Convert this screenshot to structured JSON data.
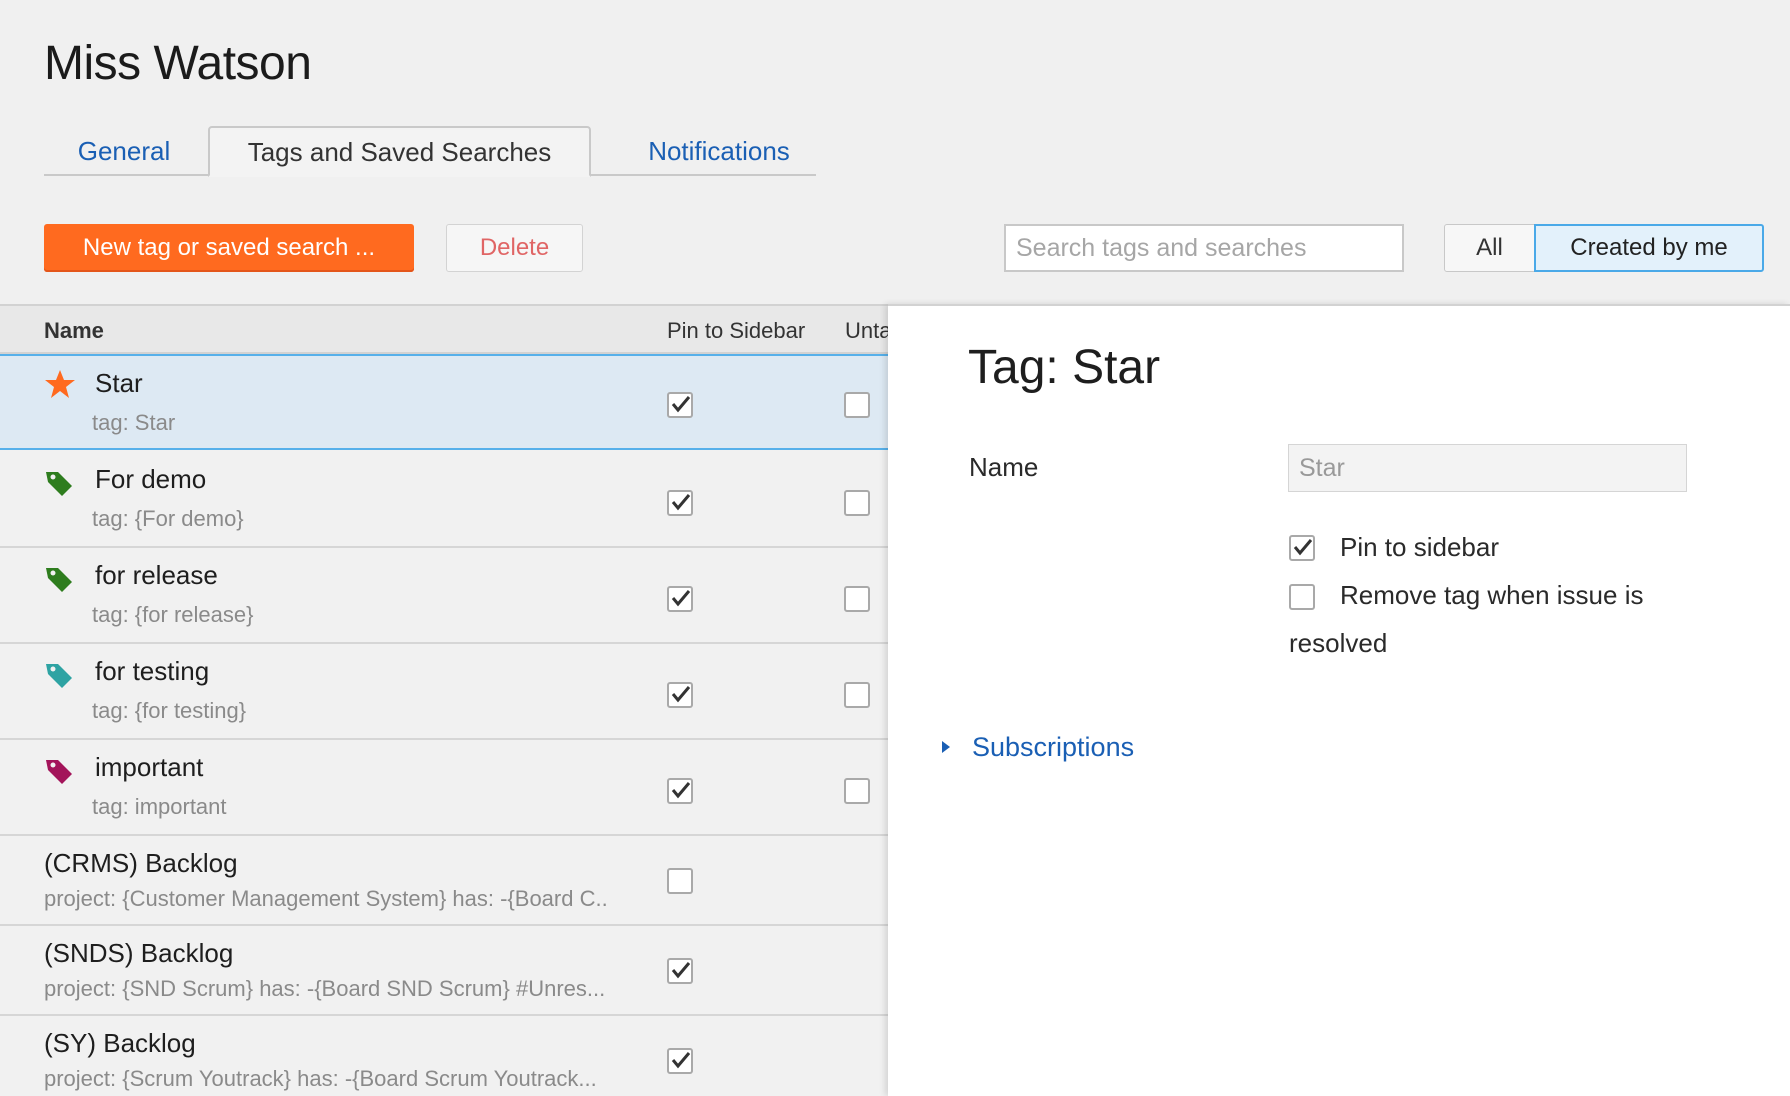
{
  "page": {
    "title": "Miss Watson"
  },
  "tabs": [
    {
      "label": "General",
      "active": false
    },
    {
      "label": "Tags and Saved Searches",
      "active": true
    },
    {
      "label": "Notifications",
      "active": false
    }
  ],
  "toolbar": {
    "new_label": "New tag or saved search ...",
    "delete_label": "Delete",
    "search_placeholder": "Search tags and searches",
    "search_value": "",
    "filter_all_label": "All",
    "filter_mine_label": "Created by me",
    "filter_selected": "Created by me"
  },
  "list": {
    "headers": {
      "name": "Name",
      "pin": "Pin to Sidebar",
      "untag": "Untag on resolve"
    },
    "rows": [
      {
        "title": "Star",
        "subtitle": "tag: Star",
        "icon": "star-icon",
        "color": "#ff6a1f",
        "pinned": true,
        "untag": false,
        "selected": true
      },
      {
        "title": "For demo",
        "subtitle": "tag: {For demo}",
        "icon": "tag-icon",
        "color": "#2e7d1e",
        "pinned": true,
        "untag": false
      },
      {
        "title": "for release",
        "subtitle": "tag: {for release}",
        "icon": "tag-icon",
        "color": "#2e7d1e",
        "pinned": true,
        "untag": false
      },
      {
        "title": "for testing",
        "subtitle": "tag: {for testing}",
        "icon": "tag-icon",
        "color": "#2ea3a3",
        "pinned": true,
        "untag": false
      },
      {
        "title": "important",
        "subtitle": "tag: important",
        "icon": "tag-icon",
        "color": "#a3145a",
        "pinned": true,
        "untag": false
      },
      {
        "title": "(CRMS) Backlog",
        "subtitle": "project: {Customer Management System} has: -{Board C..",
        "icon": "",
        "pinned": false
      },
      {
        "title": "(SNDS) Backlog",
        "subtitle": "project: {SND Scrum} has: -{Board SND Scrum} #Unres...",
        "icon": "",
        "pinned": true
      },
      {
        "title": "(SY) Backlog",
        "subtitle": "project: {Scrum Youtrack} has: -{Board Scrum Youtrack...",
        "icon": "",
        "pinned": true
      }
    ]
  },
  "detail": {
    "title": "Tag: Star",
    "name_label": "Name",
    "name_value": "Star",
    "pin_label": "Pin to sidebar",
    "pin_checked": true,
    "remove_label_line1": "Remove tag when issue is",
    "remove_label_line2": "resolved",
    "remove_checked": false,
    "subscriptions_label": "Subscriptions"
  }
}
